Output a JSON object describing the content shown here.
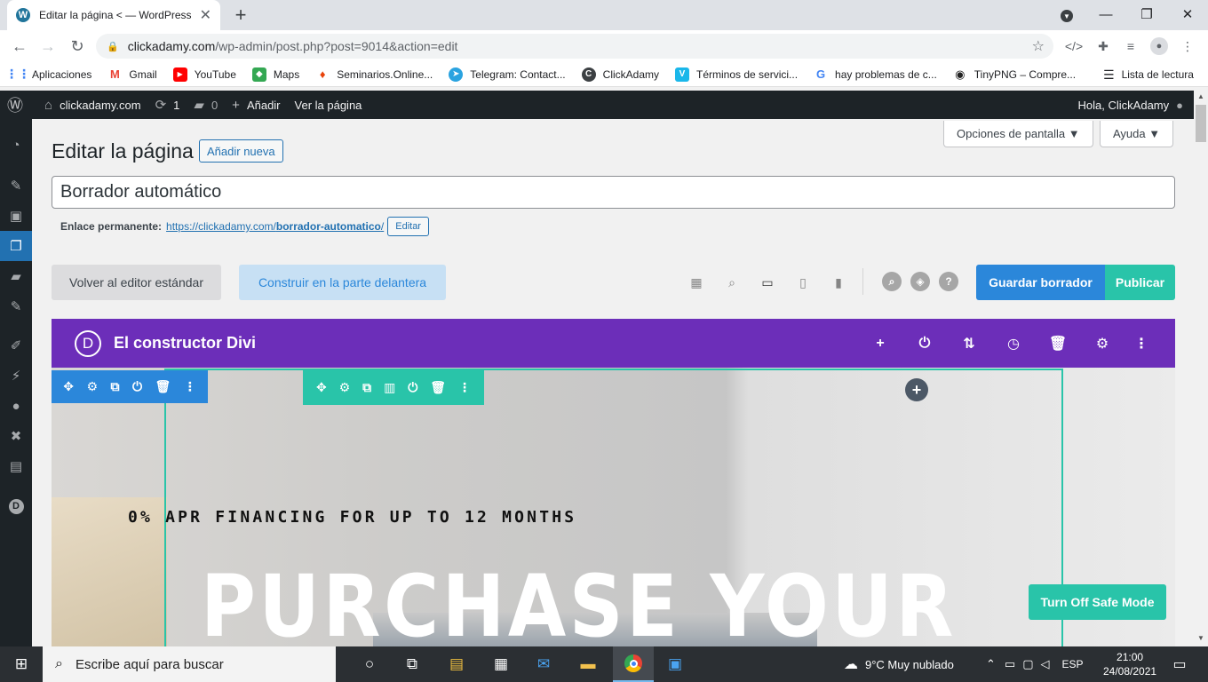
{
  "browser": {
    "tab_title": "Editar la página < — WordPress",
    "url_host": "clickadamy.com",
    "url_path": "/wp-admin/post.php?post=9014&action=edit",
    "bookmarks": [
      "Aplicaciones",
      "Gmail",
      "YouTube",
      "Maps",
      "Seminarios.Online...",
      "Telegram: Contact...",
      "ClickAdamy",
      "Términos de servici...",
      "hay problemas de c...",
      "TinyPNG – Compre..."
    ],
    "reading_list": "Lista de lectura"
  },
  "adminbar": {
    "site": "clickadamy.com",
    "updates": "1",
    "comments": "0",
    "add_new": "Añadir",
    "view_page": "Ver la página",
    "howdy": "Hola, ClickAdamy"
  },
  "screen": {
    "options": "Opciones de pantalla ▼",
    "help": "Ayuda ▼"
  },
  "page": {
    "title": "Editar la página",
    "add_new": "Añadir nueva",
    "post_title": "Borrador automático",
    "permalink_label": "Enlace permanente:",
    "permalink_base": "https://clickadamy.com/",
    "permalink_slug": "borrador-automatico",
    "permalink_end": "/",
    "permalink_edit": "Editar"
  },
  "divi": {
    "btn_standard": "Volver al editor estándar",
    "btn_frontend": "Construir en la parte delantera",
    "save": "Guardar borrador",
    "publish": "Publicar",
    "builder_title": "El constructor Divi",
    "logo_letter": "D",
    "subheading": "0% APR FINANCING FOR UP TO 12 MONTHS",
    "heading": "PURCHASE YOUR",
    "safe_mode": "Turn Off Safe Mode",
    "accent_purple": "#6c2eb9",
    "accent_blue": "#2b87da",
    "accent_teal": "#29c4a9"
  },
  "taskbar": {
    "search": "Escribe aquí para buscar",
    "weather": "9°C  Muy nublado",
    "lang": "ESP",
    "time": "21:00",
    "date": "24/08/2021"
  }
}
